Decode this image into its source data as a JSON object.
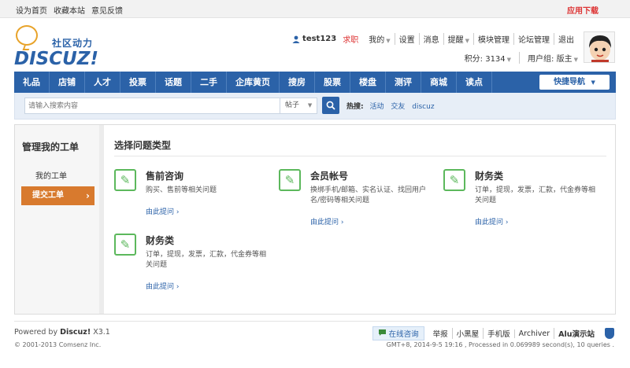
{
  "topbar": {
    "links": [
      "设为首页",
      "收藏本站",
      "意见反馈"
    ],
    "app_download": "应用下载"
  },
  "logo": {
    "subtitle": "社区动力",
    "name": "DISCUZ!"
  },
  "user": {
    "username": "test123",
    "job": "求职",
    "menu": [
      "我的",
      "设置",
      "消息",
      "提醒",
      "模块管理",
      "论坛管理",
      "退出"
    ],
    "points": "积分: 3134",
    "group": "用户组: 版主"
  },
  "nav": {
    "items": [
      "礼品",
      "店铺",
      "人才",
      "投票",
      "话题",
      "二手",
      "企库黄页",
      "搜房",
      "股票",
      "楼盘",
      "测评",
      "商城",
      "读点"
    ],
    "quick_nav": "快捷导航"
  },
  "search": {
    "placeholder": "请输入搜索内容",
    "type": "帖子",
    "hot_label": "热搜:",
    "hot_keywords": [
      "活动",
      "交友",
      "discuz"
    ]
  },
  "sidebar": {
    "title": "管理我的工单",
    "my_tickets": "我的工单",
    "submit": "提交工单"
  },
  "content": {
    "heading": "选择问题类型",
    "cards": [
      {
        "title": "售前咨询",
        "desc": "购买、售前等相关问题",
        "link": "由此提问 ›"
      },
      {
        "title": "会员帐号",
        "desc": "换绑手机/邮箱、实名认证、找回用户名/密码等相关问题",
        "link": "由此提问 ›"
      },
      {
        "title": "财务类",
        "desc": "订单，提现，发票，汇款，代金券等相关问题",
        "link": "由此提问 ›"
      },
      {
        "title": "财务类",
        "desc": "订单，提现，发票，汇款，代金券等相关问题",
        "link": "由此提问 ›"
      }
    ]
  },
  "footer": {
    "powered_prefix": "Powered by",
    "powered_brand": "Discuz!",
    "powered_version": "X3.1",
    "copyright": "© 2001-2013 Comsenz Inc.",
    "online": "在线咨询",
    "links": [
      "举报",
      "小黑屋",
      "手机版",
      "Archiver"
    ],
    "site": "Alu演示站",
    "gmt": "GMT+8, 2014-9-5 19:16 , Processed in 0.069989 second(s), 10 queries ."
  }
}
